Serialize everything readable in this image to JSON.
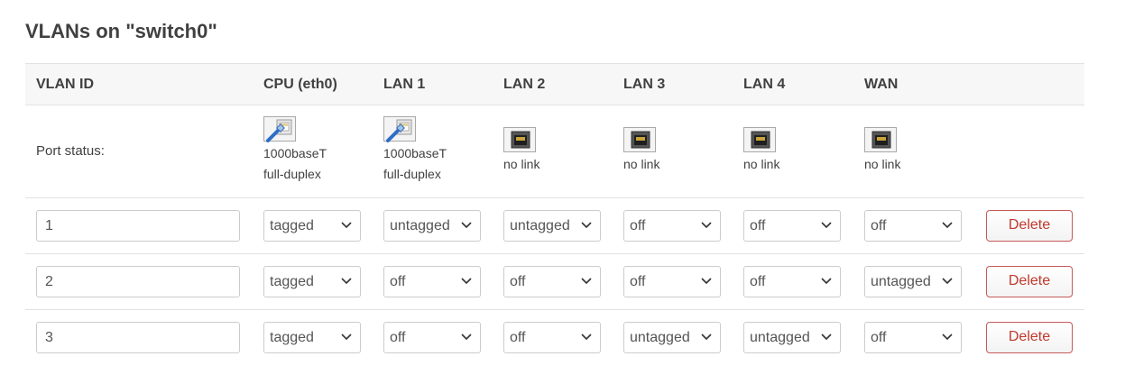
{
  "title": "VLANs on \"switch0\"",
  "headers": {
    "vlan_id": "VLAN ID",
    "cpu": "CPU (eth0)",
    "lan1": "LAN 1",
    "lan2": "LAN 2",
    "lan3": "LAN 3",
    "lan4": "LAN 4",
    "wan": "WAN"
  },
  "port_status": {
    "label": "Port status:",
    "cpu": {
      "line1": "1000baseT",
      "line2": "full-duplex",
      "icon": "port-connected-icon"
    },
    "lan1": {
      "line1": "1000baseT",
      "line2": "full-duplex",
      "icon": "port-connected-icon"
    },
    "lan2": {
      "line1": "no link",
      "icon": "port-disconnected-icon"
    },
    "lan3": {
      "line1": "no link",
      "icon": "port-disconnected-icon"
    },
    "lan4": {
      "line1": "no link",
      "icon": "port-disconnected-icon"
    },
    "wan": {
      "line1": "no link",
      "icon": "port-disconnected-icon"
    }
  },
  "vlans": [
    {
      "id": "1",
      "cpu": "tagged",
      "lan1": "untagged",
      "lan2": "untagged",
      "lan3": "off",
      "lan4": "off",
      "wan": "off",
      "delete_label": "Delete"
    },
    {
      "id": "2",
      "cpu": "tagged",
      "lan1": "off",
      "lan2": "off",
      "lan3": "off",
      "lan4": "off",
      "wan": "untagged",
      "delete_label": "Delete"
    },
    {
      "id": "3",
      "cpu": "tagged",
      "lan1": "off",
      "lan2": "off",
      "lan3": "untagged",
      "lan4": "untagged",
      "wan": "off",
      "delete_label": "Delete"
    }
  ],
  "colors": {
    "delete_text": "#c0392b",
    "delete_border": "#c65a5a",
    "header_bg": "#f7f7f7"
  }
}
